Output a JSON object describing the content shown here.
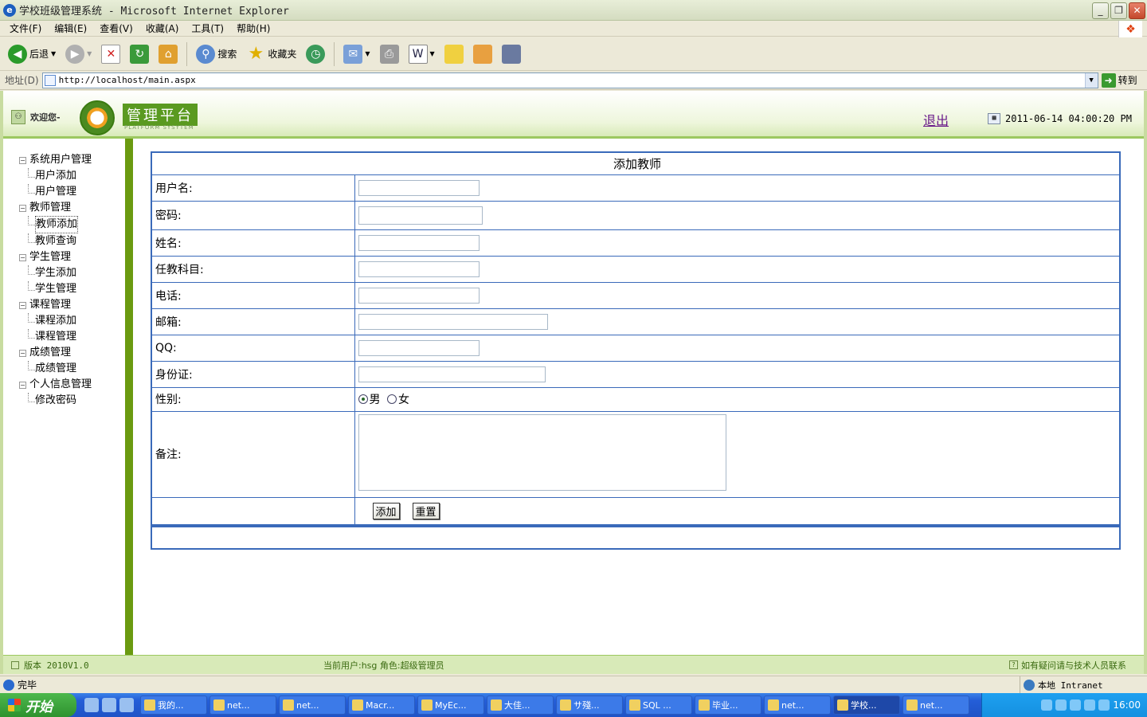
{
  "window": {
    "title": "学校班级管理系统 - Microsoft Internet Explorer"
  },
  "menu": {
    "items": [
      "文件(F)",
      "编辑(E)",
      "查看(V)",
      "收藏(A)",
      "工具(T)",
      "帮助(H)"
    ]
  },
  "toolbar": {
    "back_label": "后退",
    "search_label": "搜索",
    "favorites_label": "收藏夹"
  },
  "address": {
    "label": "地址(D)",
    "url": "http://localhost/main.aspx",
    "go_label": "转到"
  },
  "header": {
    "welcome": "欢迎您-",
    "logo_text": "管理平台",
    "logo_sub": "PLATFORM SYSYTEM",
    "logout": "退出",
    "datetime": "2011-06-14 04:00:20 PM"
  },
  "sidebar": {
    "groups": [
      {
        "label": "系统用户管理",
        "items": [
          "用户添加",
          "用户管理"
        ]
      },
      {
        "label": "教师管理",
        "items": [
          "教师添加",
          "教师查询"
        ]
      },
      {
        "label": "学生管理",
        "items": [
          "学生添加",
          "学生管理"
        ]
      },
      {
        "label": "课程管理",
        "items": [
          "课程添加",
          "课程管理"
        ]
      },
      {
        "label": "成绩管理",
        "items": [
          "成绩管理"
        ]
      },
      {
        "label": "个人信息管理",
        "items": [
          "修改密码"
        ]
      }
    ]
  },
  "form": {
    "title": "添加教师",
    "username_label": "用户名:",
    "password_label": "密码:",
    "name_label": "姓名:",
    "subject_label": "任教科目:",
    "phone_label": "电话:",
    "email_label": "邮箱:",
    "qq_label": "QQ:",
    "idcard_label": "身份证:",
    "gender_label": "性别:",
    "gender_male": "男",
    "gender_female": "女",
    "notes_label": "备注:",
    "add_button": "添加",
    "reset_button": "重置"
  },
  "footer": {
    "version": "版本 2010V1.0",
    "current_user": "当前用户:hsg 角色:超级管理员",
    "help": "如有疑问请与技术人员联系"
  },
  "status": {
    "text": "完毕",
    "zone": "本地 Intranet"
  },
  "taskbar": {
    "start": "开始",
    "tasks": [
      "我的...",
      "net...",
      "net...",
      "Macr...",
      "MyEc...",
      "大佳...",
      "サ殘...",
      "SQL ...",
      "毕业...",
      "net...",
      "学校...",
      "net..."
    ],
    "time": "16:00"
  }
}
